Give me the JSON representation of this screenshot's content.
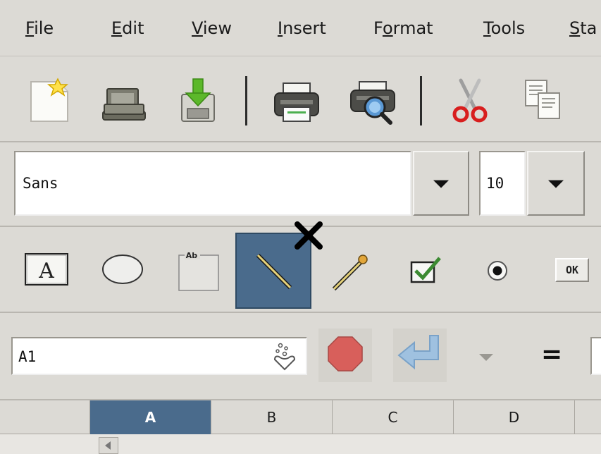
{
  "menubar": {
    "items": [
      {
        "label": "File",
        "accel": "F",
        "rest": "ile"
      },
      {
        "label": "Edit",
        "accel": "E",
        "rest": "dit"
      },
      {
        "label": "View",
        "accel": "V",
        "rest": "iew"
      },
      {
        "label": "Insert",
        "accel": "I",
        "rest": "nsert"
      },
      {
        "label": "Format",
        "pre": "F",
        "accel": "o",
        "rest": "rmat"
      },
      {
        "label": "Tools",
        "accel": "T",
        "rest": "ools"
      },
      {
        "label": "Sta",
        "accel": "S",
        "rest": "ta"
      }
    ]
  },
  "toolbar": {
    "icons": [
      "new-document-icon",
      "open-folder-icon",
      "save-icon",
      "print-icon",
      "print-preview-icon",
      "cut-icon",
      "copy-icon"
    ]
  },
  "fontbar": {
    "font_name": "Sans",
    "font_size": "10"
  },
  "drawbar": {
    "icons": [
      "text-box-icon",
      "ellipse-icon",
      "label-icon",
      "line-icon",
      "arrow-icon",
      "checkbox-icon",
      "radio-icon",
      "button-icon"
    ],
    "active": "line-icon",
    "button_label": "OK",
    "label_text": "Ab",
    "text_box_letter": "A"
  },
  "formulabar": {
    "cell_ref": "A1",
    "equals": "="
  },
  "columns": {
    "headers": [
      "A",
      "B",
      "C",
      "D"
    ],
    "active": "A"
  },
  "colors": {
    "accent": "#4a6b8c",
    "background": "#dcdad5"
  }
}
